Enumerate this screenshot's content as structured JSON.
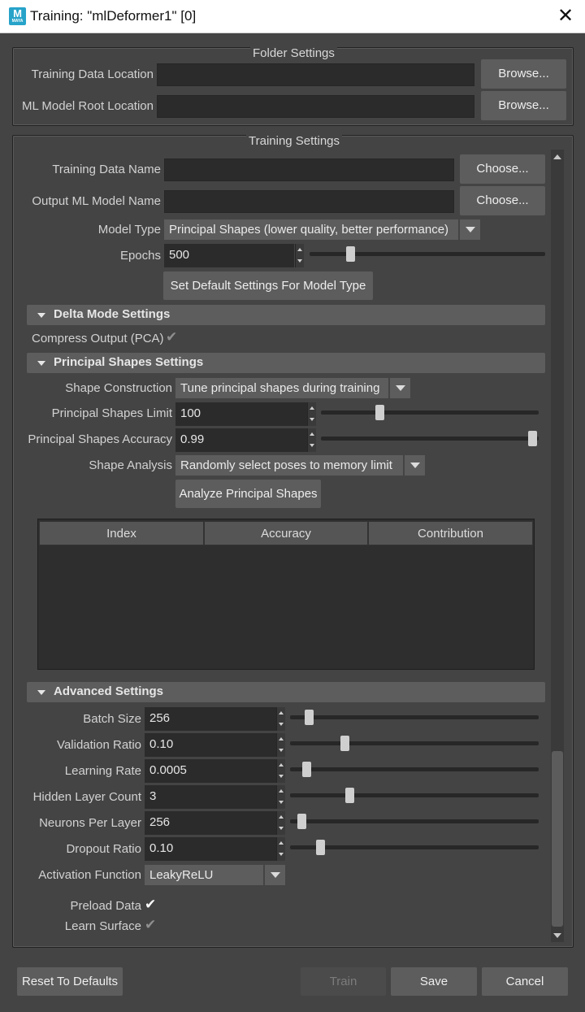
{
  "window": {
    "title": "Training: \"mlDeformer1\" [0]",
    "icon": "maya-app-icon",
    "icon_letter": "M",
    "icon_sub": "MAYA"
  },
  "folder_settings": {
    "title": "Folder Settings",
    "training_data_location_label": "Training Data Location",
    "training_data_location_value": "",
    "ml_model_root_label": "ML Model Root Location",
    "ml_model_root_value": "",
    "browse_label": "Browse..."
  },
  "training_settings": {
    "title": "Training Settings",
    "training_data_name_label": "Training Data Name",
    "output_model_name_label": "Output ML Model Name",
    "choose_label": "Choose...",
    "model_type_label": "Model Type",
    "model_type_value": "Principal Shapes (lower quality, better performance)",
    "epochs_label": "Epochs",
    "epochs_value": "500",
    "epochs_slider": 0.12,
    "set_defaults_label": "Set Default Settings For Model Type"
  },
  "delta_mode": {
    "title": "Delta Mode Settings",
    "compress_label": "Compress Output (PCA)",
    "compress_checked": true
  },
  "principal_shapes": {
    "title": "Principal Shapes Settings",
    "shape_construction_label": "Shape Construction",
    "shape_construction_value": "Tune principal shapes during training",
    "limit_label": "Principal Shapes Limit",
    "limit_value": "100",
    "limit_slider": 0.27,
    "accuracy_label": "Principal Shapes Accuracy",
    "accuracy_value": "0.99",
    "accuracy_slider": 0.99,
    "analysis_label": "Shape Analysis",
    "analysis_value": "Randomly select poses to memory limit",
    "analyze_button": "Analyze Principal Shapes",
    "table_headers": [
      "Index",
      "Accuracy",
      "Contribution"
    ]
  },
  "advanced": {
    "title": "Advanced Settings",
    "rows": [
      {
        "label": "Batch Size",
        "value": "256",
        "slider": 0.06
      },
      {
        "label": "Validation Ratio",
        "value": "0.10",
        "slider": 0.21
      },
      {
        "label": "Learning Rate",
        "value": "0.0005",
        "slider": 0.05
      },
      {
        "label": "Hidden Layer Count",
        "value": "3",
        "slider": 0.23
      },
      {
        "label": "Neurons Per Layer",
        "value": "256",
        "slider": 0.03
      },
      {
        "label": "Dropout Ratio",
        "value": "0.10",
        "slider": 0.11
      }
    ],
    "activation_label": "Activation Function",
    "activation_value": "LeakyReLU",
    "preload_label": "Preload Data",
    "preload_checked": true,
    "learn_surface_label": "Learn Surface",
    "learn_surface_checked": true
  },
  "footer": {
    "reset_label": "Reset To Defaults",
    "train_label": "Train",
    "save_label": "Save",
    "cancel_label": "Cancel"
  }
}
